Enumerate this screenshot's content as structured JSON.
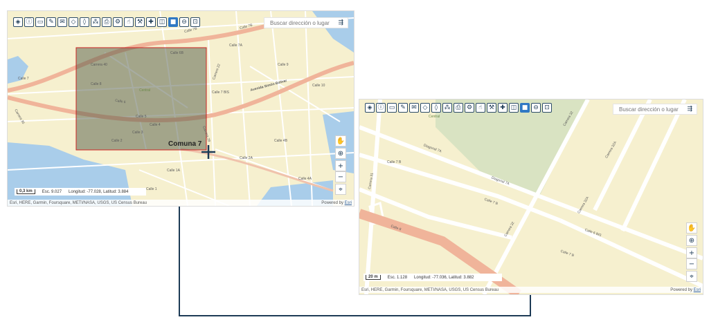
{
  "toolbar": {
    "icons": [
      "layers-icon",
      "info-icon",
      "measure-icon",
      "pencil-icon",
      "speech-bubble-icon",
      "eraser-icon",
      "tag-icon",
      "network-icon",
      "printer-icon",
      "share-icon",
      "hand-icon",
      "tools-icon",
      "plus-cross-icon",
      "split-view-icon",
      "rectangle-zoom-icon",
      "zoom-out-icon",
      "zoom-select-icon"
    ]
  },
  "search": {
    "placeholder": "Buscar dirección o lugar"
  },
  "map_overview": {
    "district_label": "Comuna 7",
    "scale_label": "0,3 km",
    "scale_text": "Esc. 9.027",
    "coords": "Longitud: -77.028, Latitud: 3.884",
    "streets": [
      "Calle 7B",
      "Calle 7A",
      "Calle 7",
      "Calle 7B",
      "Calle 6",
      "Calle 5",
      "Calle 4",
      "Calle 3",
      "Calle 2",
      "Calle 1",
      "Avenida Simón Bolívar",
      "Carrera 35",
      "Carrera 40",
      "Calle 10",
      "Calle 9",
      "Calle 4A",
      "Calle 2A",
      "Calle 1A",
      "Calle 7 BIS",
      "Carrera 22",
      "Calle 6B",
      "Calle 8",
      "Carrera 28",
      "Calle 4B",
      "Central"
    ]
  },
  "map_detail": {
    "scale_label": "20 m",
    "scale_text": "Esc. 1.128",
    "coords": "Longitud: -77.036, Latitud: 3.882",
    "streets": [
      "Diagonal 7A",
      "Diagonal 7A",
      "Calle 7 B",
      "Carrera 31",
      "Calle 7 B",
      "Calle 8",
      "Carrera 32",
      "Carrera 32",
      "Carrera 32A",
      "Carrera 32A",
      "Calle 6 BIS",
      "Calle 7 B",
      "Central"
    ]
  },
  "attribution": {
    "text": "Esri, HERE, Garmin, Foursquare, METI/NASA, USGS, US Census Bureau",
    "powered": "Powered by",
    "powered_link": "Esri"
  },
  "side_controls": [
    "pan-hand-icon",
    "globe-icon",
    "zoom-in-icon",
    "zoom-out-icon",
    "locate-icon"
  ],
  "side_glyphs": [
    "✋",
    "⊕",
    "+",
    "−",
    "⌖"
  ],
  "toolbar_glyphs": [
    "◈",
    "ⓘ",
    "▭",
    "✎",
    "✉",
    "◇",
    "◊",
    "⁂",
    "⎙",
    "⚙",
    "☝",
    "⚒",
    "✚",
    "◫",
    "■",
    "⊖",
    "⊡"
  ],
  "colors": {
    "selection": "#cc2222",
    "road": "#f0b49a",
    "water": "#a9cdea",
    "park": "#d9e3c2",
    "connector": "#1c3a55"
  }
}
